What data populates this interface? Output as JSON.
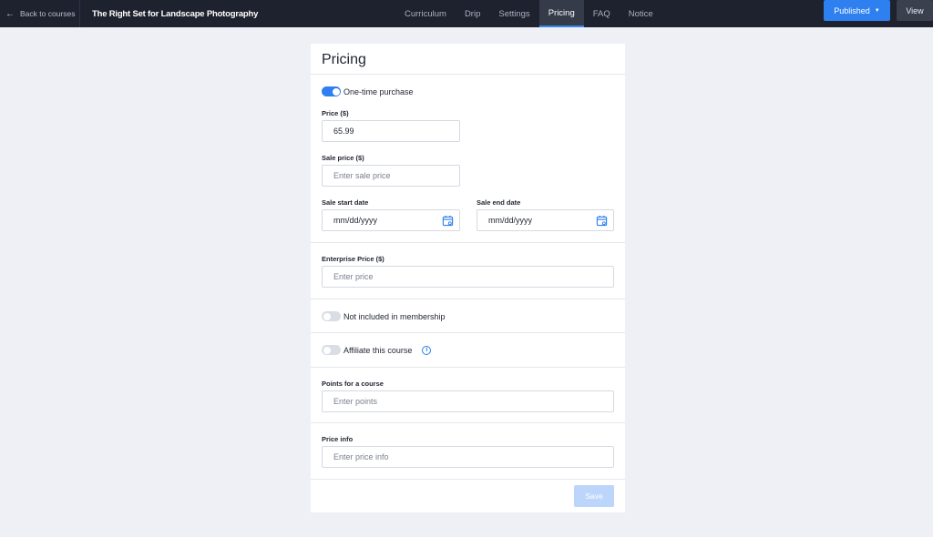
{
  "topbar": {
    "back_label": "Back to courses",
    "course_title": "The Right Set for Landscape Photography",
    "tabs": [
      {
        "label": "Curriculum"
      },
      {
        "label": "Drip"
      },
      {
        "label": "Settings"
      },
      {
        "label": "Pricing",
        "active": true
      },
      {
        "label": "FAQ"
      },
      {
        "label": "Notice"
      }
    ],
    "status_label": "Published",
    "view_label": "View",
    "accent_color": "#2e7ff0"
  },
  "pricing": {
    "title": "Pricing",
    "one_time": {
      "label": "One-time purchase",
      "enabled": true
    },
    "price": {
      "label": "Price ($)",
      "value": "65.99"
    },
    "sale_price": {
      "label": "Sale price ($)",
      "placeholder": "Enter sale price"
    },
    "sale_start": {
      "label": "Sale start date",
      "placeholder": "mm/dd/yyyy"
    },
    "sale_end": {
      "label": "Sale end date",
      "placeholder": "mm/dd/yyyy"
    },
    "enterprise_price": {
      "label": "Enterprise Price ($)",
      "placeholder": "Enter price"
    },
    "membership": {
      "label": "Not included in membership",
      "enabled": false
    },
    "affiliate": {
      "label": "Affiliate this course",
      "enabled": false
    },
    "points": {
      "label": "Points for a course",
      "placeholder": "Enter points"
    },
    "price_info": {
      "label": "Price info",
      "placeholder": "Enter price info"
    },
    "save_label": "Save"
  }
}
